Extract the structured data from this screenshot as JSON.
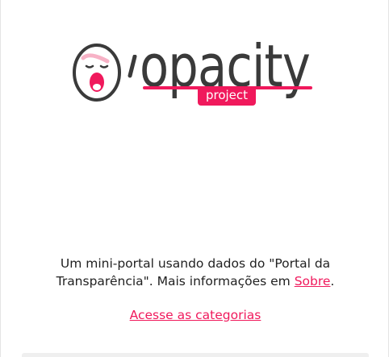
{
  "logo": {
    "wordmark": "opacity",
    "apostrophe": "'",
    "badge": "project",
    "accent_color": "#f0195c",
    "mascot_icon": "screaming-face-icon"
  },
  "intro": {
    "line1_prefix": "Um mini-portal usando dados do \"Portal da",
    "line2_prefix": "Transparência\". Mais informações em ",
    "about_link": "Sobre",
    "line2_suffix": "."
  },
  "cta": {
    "categories_link": "Acesse as categorias"
  }
}
